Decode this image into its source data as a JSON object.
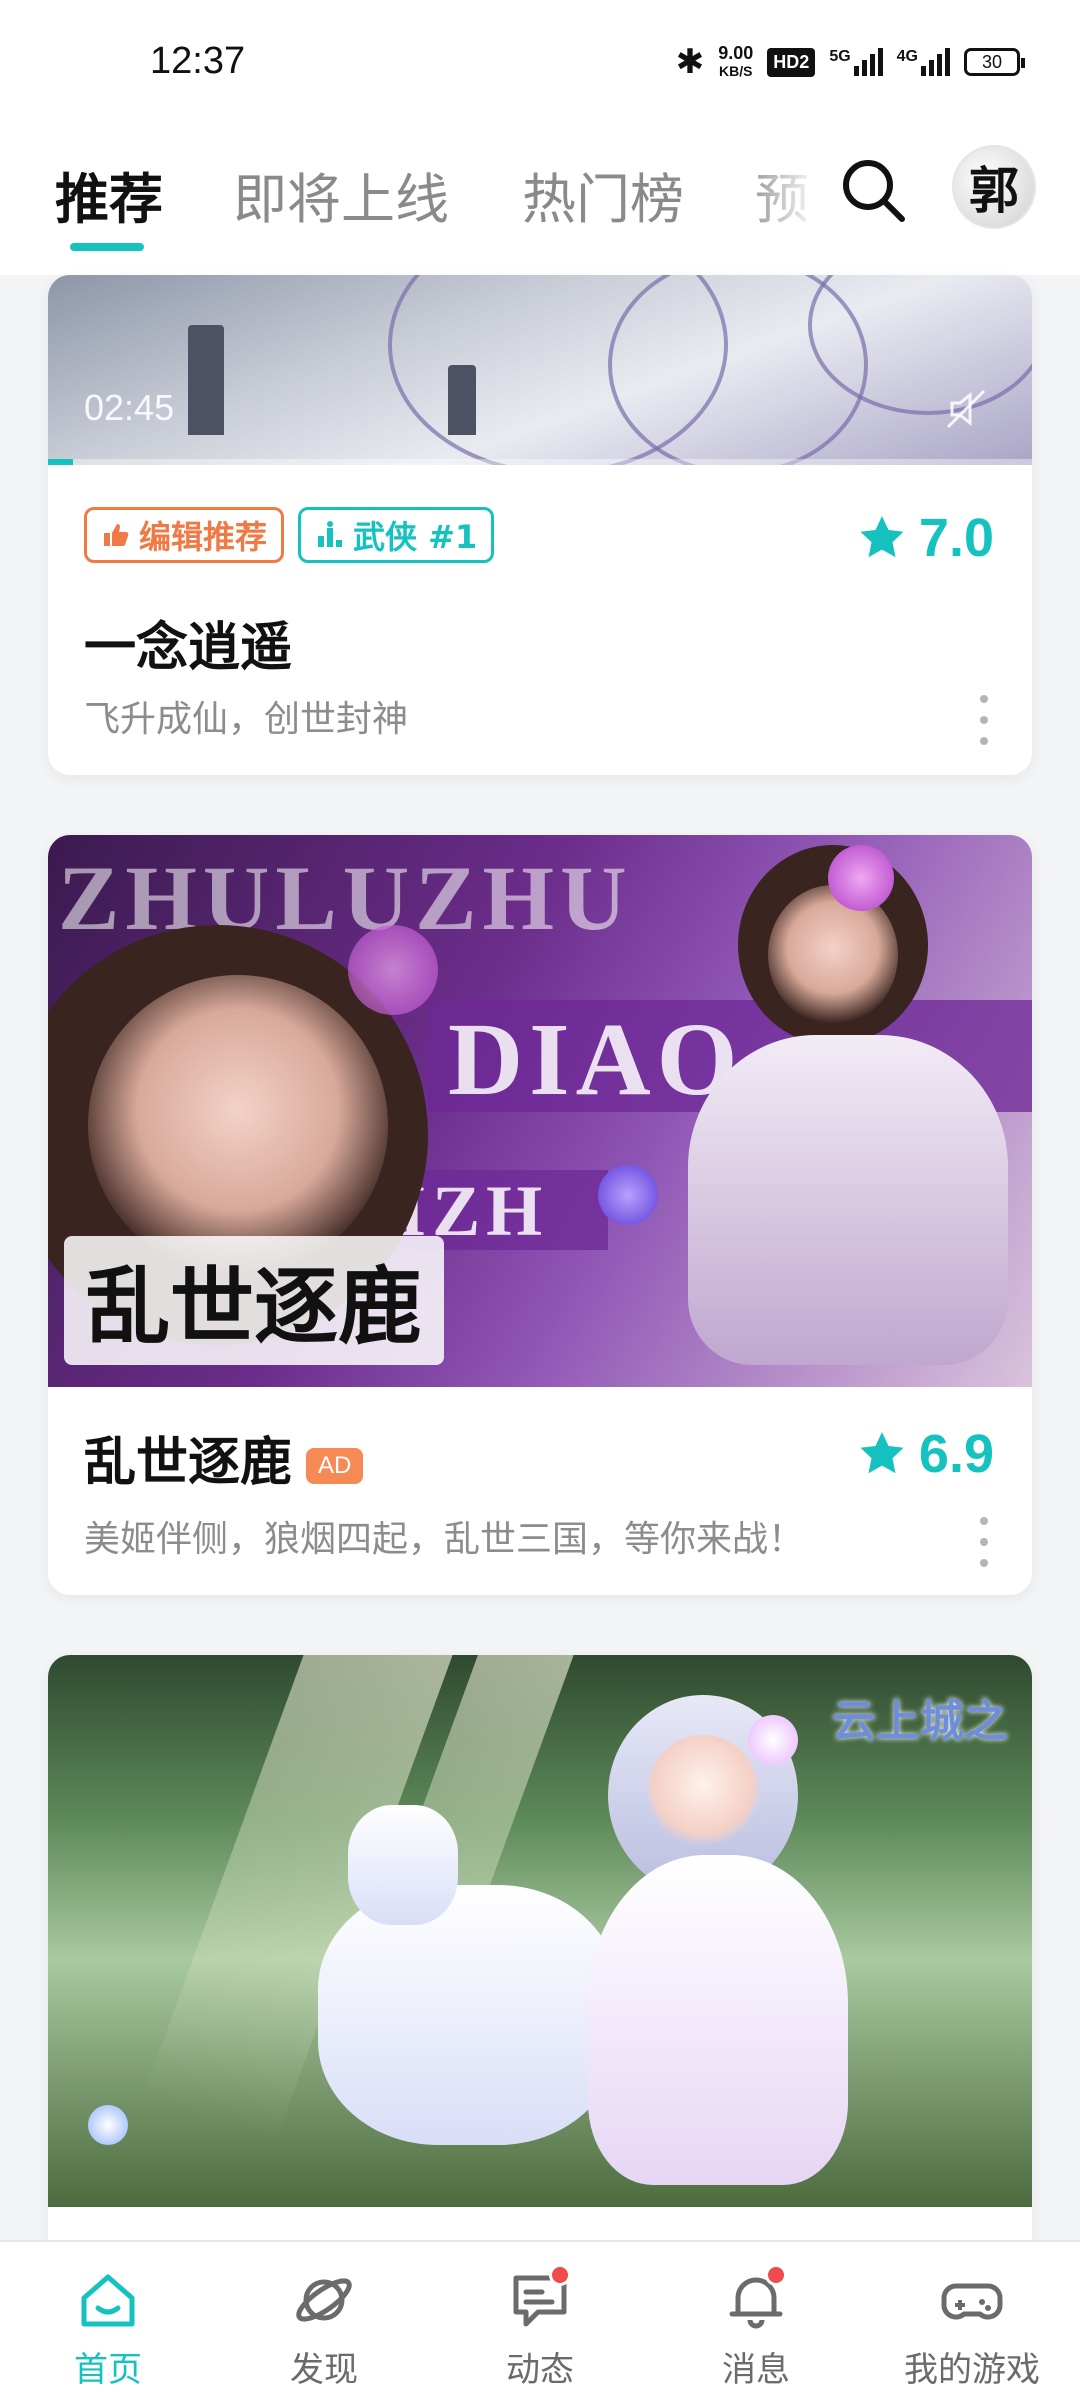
{
  "status_bar": {
    "time": "12:37",
    "net_speed_value": "9.00",
    "net_speed_unit": "KB/S",
    "hd_label": "HD2",
    "sim1_label": "5G",
    "sim2_label": "4G",
    "battery": "30"
  },
  "top_nav": {
    "tabs": [
      {
        "label": "推荐"
      },
      {
        "label": "即将上线"
      },
      {
        "label": "热门榜"
      },
      {
        "label": "预"
      }
    ],
    "avatar_text": "郭"
  },
  "cards": [
    {
      "video_time": "02:45",
      "video_progress_percent": 2.5,
      "tags": [
        {
          "label": "编辑推荐",
          "icon": "thumbs-up-icon"
        },
        {
          "label": "武侠 #1",
          "icon": "rank-icon"
        }
      ],
      "rating": "7.0",
      "title": "一念逍遥",
      "description": "飞升成仙，创世封神"
    },
    {
      "banner": {
        "text_top": "ZHULUZHU",
        "text_mid": "DIAO",
        "text_bottom": "LUANSHIZH",
        "logo": "乱世逐鹿"
      },
      "title": "乱世逐鹿",
      "ad_badge": "AD",
      "rating": "6.9",
      "description": "美姬伴侧，狼烟四起，乱世三国，等你来战！"
    },
    {
      "banner": {
        "logo": "云上城之"
      }
    }
  ],
  "bottom_nav": [
    {
      "label": "首页",
      "icon": "home-icon",
      "active": true
    },
    {
      "label": "发现",
      "icon": "planet-icon"
    },
    {
      "label": "动态",
      "icon": "chat-icon",
      "badge": true
    },
    {
      "label": "消息",
      "icon": "bell-icon",
      "badge": true
    },
    {
      "label": "我的游戏",
      "icon": "gamepad-icon"
    }
  ],
  "colors": {
    "accent": "#16c2c0",
    "tag_orange": "#f07a45",
    "badge_red": "#f04a4a"
  }
}
